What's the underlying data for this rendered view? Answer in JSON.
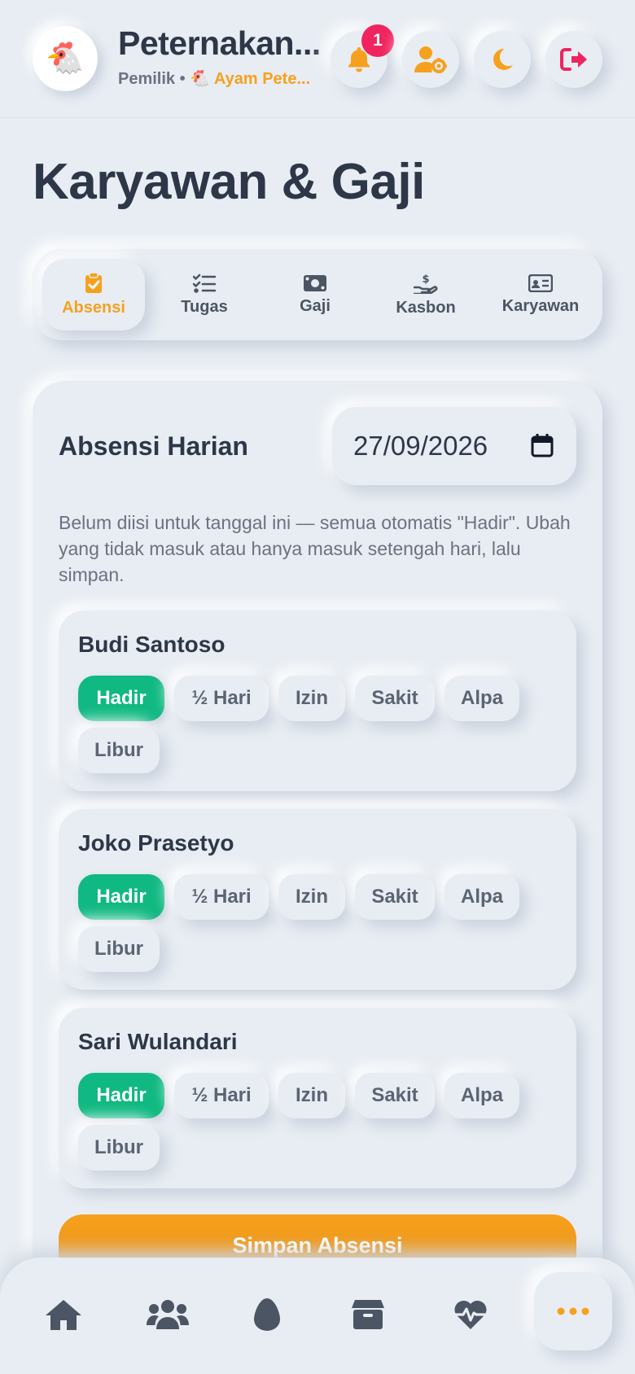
{
  "header": {
    "logo_emoji": "🐔",
    "title": "Peternakan...",
    "role": "Pemilik",
    "separator": "•",
    "farm_emoji": "🐔",
    "farm_name": "Ayam Pete...",
    "notification_count": "1",
    "accent_color": "#f6a11d",
    "alert_color": "#f0245e",
    "icons": [
      "bell-icon",
      "user-gear-icon",
      "moon-icon",
      "logout-icon"
    ]
  },
  "page": {
    "title": "Karyawan & Gaji"
  },
  "tabs": [
    {
      "label": "Absensi",
      "icon": "clipboard-check-icon",
      "active": true
    },
    {
      "label": "Tugas",
      "icon": "list-check-icon",
      "active": false
    },
    {
      "label": "Gaji",
      "icon": "money-bill-icon",
      "active": false
    },
    {
      "label": "Kasbon",
      "icon": "hand-dollar-icon",
      "active": false
    },
    {
      "label": "Karyawan",
      "icon": "id-card-icon",
      "active": false
    }
  ],
  "attendance": {
    "title": "Absensi Harian",
    "date": "27/09/2026",
    "note": "Belum diisi untuk tanggal ini — semua otomatis \"Hadir\". Ubah yang tidak masuk atau hanya masuk setengah hari, lalu simpan.",
    "status_options": [
      "Hadir",
      "½ Hari",
      "Izin",
      "Sakit",
      "Alpa",
      "Libur"
    ],
    "active_color": "#10b981",
    "employees": [
      {
        "name": "Budi Santoso",
        "status": "Hadir"
      },
      {
        "name": "Joko Prasetyo",
        "status": "Hadir"
      },
      {
        "name": "Sari Wulandari",
        "status": "Hadir"
      }
    ],
    "save_label": "Simpan Absensi"
  },
  "bottom_nav": {
    "items": [
      "home-icon",
      "users-icon",
      "egg-icon",
      "box-icon",
      "heart-pulse-icon",
      "more-icon"
    ],
    "active": "more-icon"
  }
}
